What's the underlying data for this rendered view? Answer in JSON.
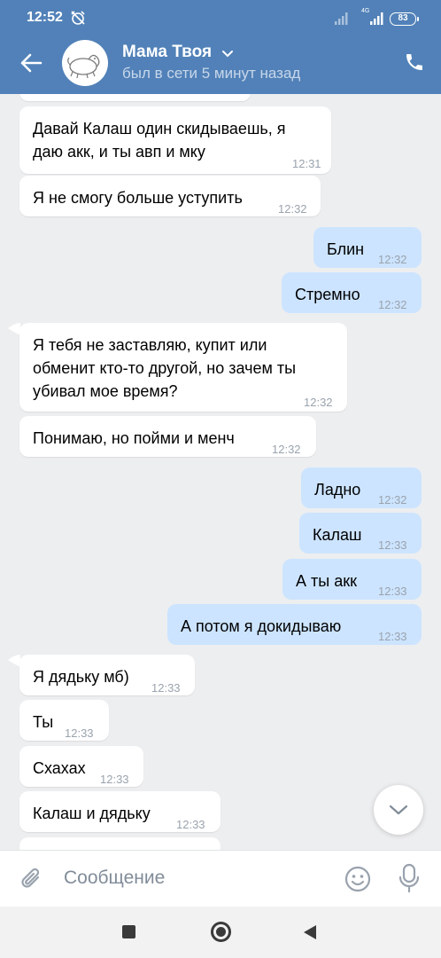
{
  "status_bar": {
    "time": "12:52",
    "network": "4G",
    "battery": "83"
  },
  "header": {
    "contact_name": "Мама Твоя",
    "contact_status": "был в сети 5 минут назад",
    "icons": [
      "back-arrow-icon",
      "chevron-down-icon",
      "phone-icon"
    ]
  },
  "messages": [
    {
      "dir": "in",
      "text": "Давай Калаш один скидываешь, я",
      "text2": "даю акк, и ты авп и мку",
      "time": "12:31"
    },
    {
      "dir": "in",
      "text": "Я не смогу больше уступить",
      "time": "12:32"
    },
    {
      "dir": "out",
      "text": "Блин",
      "time": "12:32"
    },
    {
      "dir": "out",
      "text": "Стремно",
      "time": "12:32"
    },
    {
      "dir": "in",
      "text": "Я тебя не заставляю, купит или",
      "text2": "обменит кто-то другой, но зачем ты",
      "text3": "убивал мое время?",
      "time": "12:32"
    },
    {
      "dir": "in",
      "text": "Понимаю, но пойми и менч",
      "time": "12:32"
    },
    {
      "dir": "out",
      "text": "Ладно",
      "time": "12:32"
    },
    {
      "dir": "out",
      "text": "Калаш",
      "time": "12:33"
    },
    {
      "dir": "out",
      "text": "А ты акк",
      "time": "12:33"
    },
    {
      "dir": "out",
      "text": "А потом я докидываю",
      "time": "12:33"
    },
    {
      "dir": "in",
      "text": "Я дядьку мб)",
      "time": "12:33"
    },
    {
      "dir": "in",
      "text": "Ты",
      "time": "12:33"
    },
    {
      "dir": "in",
      "text": "Схахах",
      "time": "12:33"
    },
    {
      "dir": "in",
      "text": "Калаш и дядьку",
      "time": "12:33"
    }
  ],
  "composer": {
    "placeholder": "Сообщение"
  },
  "colors": {
    "header": "#5181b8",
    "incoming": "#ffffff",
    "outgoing": "#cce4ff",
    "background": "#edeef0"
  }
}
